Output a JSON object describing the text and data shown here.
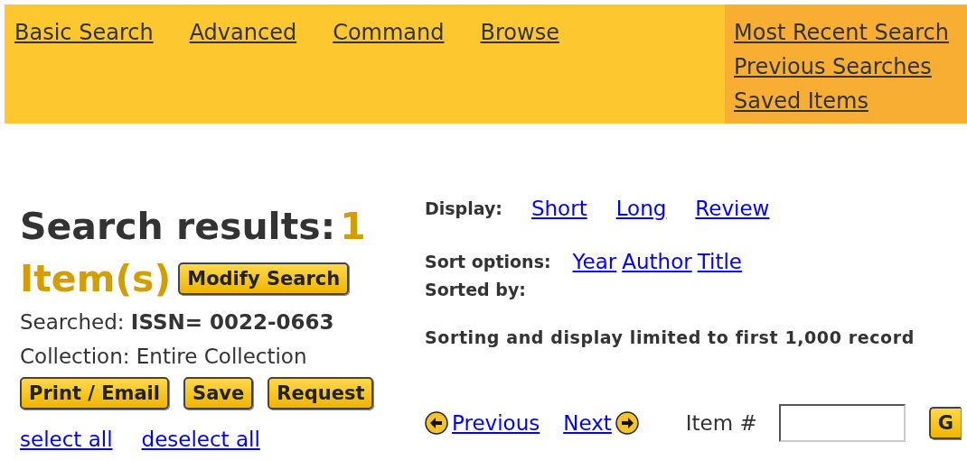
{
  "nav": {
    "links": [
      "Basic Search",
      "Advanced",
      "Command",
      "Browse"
    ],
    "side_links": [
      "Most Recent Search",
      "Previous Searches",
      "Saved Items"
    ]
  },
  "results": {
    "title": "Search results:",
    "count": "1",
    "count_label": "Item(s)",
    "modify_button": "Modify Search",
    "searched": "Searched: **ISSN= 0022-0663**",
    "collection": "Collection: Entire Collection",
    "buttons": [
      "Print / Email",
      "Save",
      "Request"
    ],
    "select_links": [
      "select all",
      "deselect all"
    ]
  },
  "display": {
    "label": "Display:",
    "links": [
      "Short",
      "Long",
      "Review"
    ]
  },
  "sort": {
    "label": "Sort options:",
    "links": [
      "Year",
      "Author",
      "Title"
    ],
    "sorted_by": "Sorted by:"
  },
  "notice": "Sorting and display limited to first 1,000 record",
  "pager": {
    "previous": "Previous",
    "next": "Next",
    "item_label": "Item #",
    "go_button": "G"
  }
}
